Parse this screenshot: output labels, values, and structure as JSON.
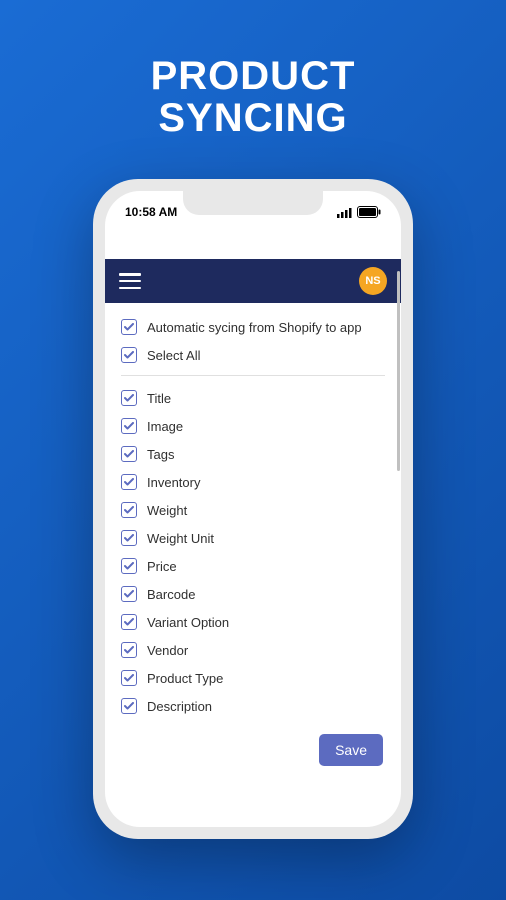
{
  "hero": {
    "line1": "PRODUCT",
    "line2": "SYNCING"
  },
  "status": {
    "time": "10:58 AM"
  },
  "header": {
    "avatar_initials": "NS"
  },
  "auto_sync": {
    "label": "Automatic sycing from Shopify to app",
    "checked": true
  },
  "select_all": {
    "label": "Select All",
    "checked": true
  },
  "fields": [
    {
      "label": "Title",
      "checked": true
    },
    {
      "label": "Image",
      "checked": true
    },
    {
      "label": "Tags",
      "checked": true
    },
    {
      "label": "Inventory",
      "checked": true
    },
    {
      "label": "Weight",
      "checked": true
    },
    {
      "label": "Weight Unit",
      "checked": true
    },
    {
      "label": "Price",
      "checked": true
    },
    {
      "label": "Barcode",
      "checked": true
    },
    {
      "label": "Variant Option",
      "checked": true
    },
    {
      "label": "Vendor",
      "checked": true
    },
    {
      "label": "Product Type",
      "checked": true
    },
    {
      "label": "Description",
      "checked": true
    }
  ],
  "actions": {
    "save_label": "Save"
  }
}
